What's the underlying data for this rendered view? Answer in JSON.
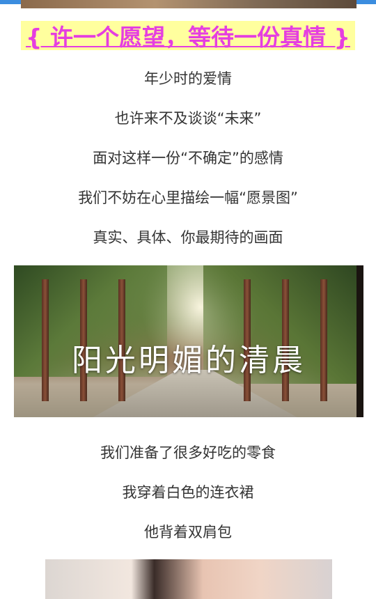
{
  "header": {
    "title": "{ 许一个愿望，等待一份真情 }"
  },
  "paragraphs_top": [
    "年少时的爱情",
    "也许来不及谈谈“未来”",
    "面对这样一份“不确定”的感情",
    "我们不妨在心里描绘一幅“愿景图”",
    "真实、具体、你最期待的画面"
  ],
  "banner": {
    "caption": "阳光明媚的清晨"
  },
  "paragraphs_bottom": [
    "我们准备了很多好吃的零食",
    "我穿着白色的连衣裙",
    "他背着双肩包"
  ],
  "colors": {
    "title": "#e53ee0",
    "title_highlight": "#ffff9e",
    "body_text": "#333333",
    "top_bar": "#3b8ddf"
  }
}
